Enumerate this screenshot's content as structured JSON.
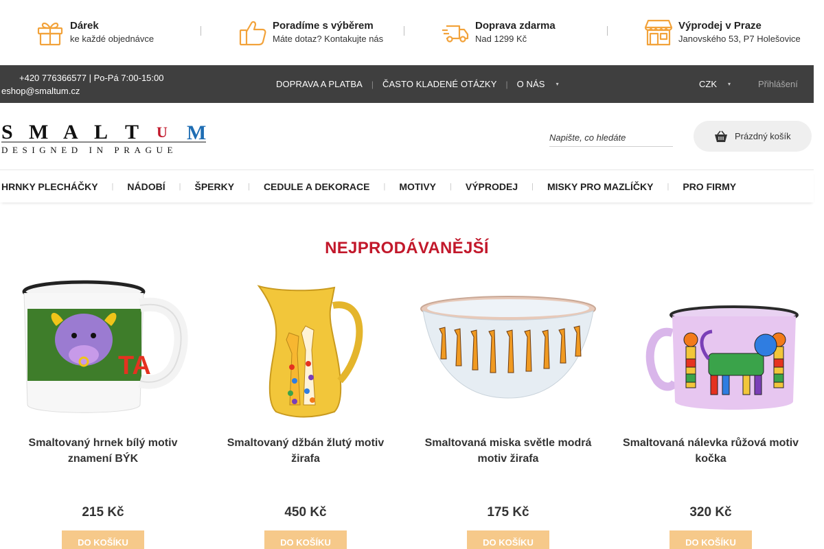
{
  "benefits": [
    {
      "icon": "gift-icon",
      "title": "Dárek",
      "subtitle": "ke každé objednávce"
    },
    {
      "icon": "thumbs-up-icon",
      "title": "Poradíme s výběrem",
      "subtitle": "Máte dotaz? Kontakujte nás"
    },
    {
      "icon": "delivery-truck-icon",
      "title": "Doprava zdarma",
      "subtitle": "Nad 1299 Kč"
    },
    {
      "icon": "shop-icon",
      "title": "Výprodej v Praze",
      "subtitle": "Janovského 53, P7 Holešovice"
    }
  ],
  "topbar": {
    "phone": "+420 776366577 | Po-Pá 7:00-15:00",
    "email": "eshop@smaltum.cz",
    "links": [
      "DOPRAVA A PLATBA",
      "ČASTO KLADENÉ OTÁZKY",
      "O NÁS"
    ],
    "currency": "CZK",
    "login": "Přihlášení"
  },
  "header": {
    "logo_text": "SMALTUM",
    "logo_tagline": "DESIGNED IN PRAGUE",
    "search_placeholder": "Napište, co hledáte",
    "cart_label": "Prázdný košík"
  },
  "categories": [
    "HRNKY PLECHÁČKY",
    "NÁDOBÍ",
    "ŠPERKY",
    "CEDULE A DEKORACE",
    "MOTIVY",
    "VÝPRODEJ",
    "MISKY PRO MAZLÍČKY",
    "PRO FIRMY"
  ],
  "bestsellers": {
    "title": "NEJPRODÁVANĚJŠÍ",
    "products": [
      {
        "name": "Smaltovaný hrnek bílý motiv znamení BÝK",
        "price": "215 Kč",
        "button": "DO KOŠÍKU",
        "image": "mug-bull-image"
      },
      {
        "name": "Smaltovaný džbán žlutý motiv žirafa",
        "price": "450 Kč",
        "button": "DO KOŠÍKU",
        "image": "jug-giraffe-image"
      },
      {
        "name": "Smaltovaná miska světle modrá motiv žirafa",
        "price": "175 Kč",
        "button": "DO KOŠÍKU",
        "image": "bowl-giraffe-image"
      },
      {
        "name": "Smaltovaná nálevka růžová motiv kočka",
        "price": "320 Kč",
        "button": "DO KOŠÍKU",
        "image": "cup-cat-image"
      }
    ]
  },
  "colors": {
    "accent_red": "#c2182b",
    "icon_orange": "#f2a23a",
    "topbar_bg": "#3f3f3f",
    "button_bg": "#f6c98a"
  }
}
